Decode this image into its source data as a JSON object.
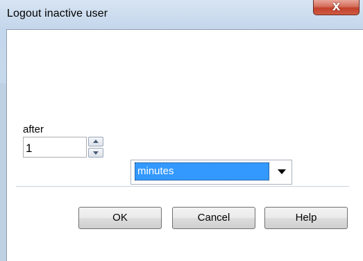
{
  "window": {
    "title": "Logout inactive user",
    "close_glyph": "X"
  },
  "form": {
    "after_label": "after",
    "amount_value": "1",
    "unit_selected": "minutes"
  },
  "buttons": {
    "ok_label": "OK",
    "cancel_label": "Cancel",
    "help_label": "Help"
  },
  "icons": {
    "close": "close-icon",
    "spin_up": "spin-up-arrow-icon",
    "spin_down": "spin-down-arrow-icon",
    "dropdown": "chevron-down-icon"
  },
  "colors": {
    "selection_highlight": "#3399ff",
    "close_button": "#c2412b",
    "frame": "#c9daed"
  }
}
